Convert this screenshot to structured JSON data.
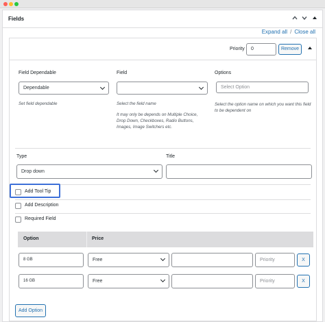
{
  "panel": {
    "title": "Fields",
    "up_icon": "chevron-up-icon",
    "down_icon": "chevron-down-icon",
    "toggle_icon": "triangle-up-icon",
    "expand_all": "Expand all",
    "separator": "/",
    "close_all": "Close all"
  },
  "field_block": {
    "priority_label": "Priority",
    "priority_value": "0",
    "remove_label": "Remove",
    "collapse_icon": "triangle-up-icon",
    "dependable": {
      "label": "Field Dependable",
      "value": "Dependable",
      "help": "Set field dependable"
    },
    "field": {
      "label": "Field",
      "value": "",
      "help": "Select the field name",
      "note": "It may only be depends on Multiple Choice, Drop Down, Checkboxes, Radio Buttons, Images, Image Switchers etc."
    },
    "options": {
      "label": "Options",
      "placeholder": "Select Option",
      "help": "Select the option name on which you want this field to be dependent on"
    },
    "type": {
      "label": "Type",
      "value": "Drop down"
    },
    "title": {
      "label": "Title",
      "value": ""
    },
    "checkboxes": {
      "tooltip": "Add Tool Tip",
      "description": "Add Description",
      "required": "Required Field"
    },
    "table": {
      "col_option": "Option",
      "col_price": "Price",
      "rows": [
        {
          "option": "8 GB",
          "price_type": "Free",
          "price": "",
          "priority_placeholder": "Priority",
          "remove": "X"
        },
        {
          "option": "16 GB",
          "price_type": "Free",
          "price": "",
          "priority_placeholder": "Priority",
          "remove": "X"
        }
      ]
    },
    "add_option": "Add Option"
  }
}
